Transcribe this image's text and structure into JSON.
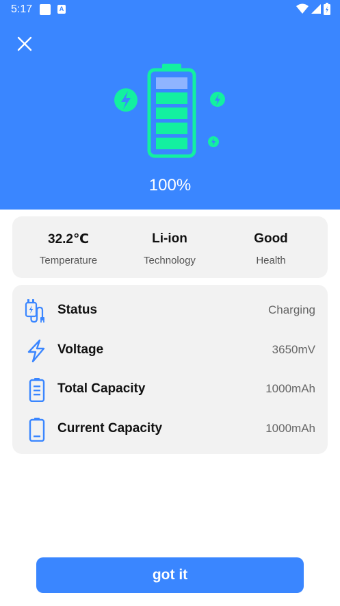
{
  "status_bar": {
    "time": "5:17"
  },
  "battery": {
    "percent": "100%"
  },
  "stats": [
    {
      "value": "32.2℃",
      "label": "Temperature"
    },
    {
      "value": "Li-ion",
      "label": "Technology"
    },
    {
      "value": "Good",
      "label": "Health"
    }
  ],
  "details": [
    {
      "label": "Status",
      "value": "Charging",
      "icon": "charger-plug-icon"
    },
    {
      "label": "Voltage",
      "value": "3650mV",
      "icon": "lightning-icon"
    },
    {
      "label": "Total Capacity",
      "value": "1000mAh",
      "icon": "battery-full-icon"
    },
    {
      "label": "Current Capacity",
      "value": "1000mAh",
      "icon": "battery-empty-icon"
    }
  ],
  "actions": {
    "confirm_label": "got it"
  },
  "colors": {
    "accent": "#3a86ff",
    "battery_green": "#13f0a0",
    "card_bg": "#f2f2f2"
  }
}
